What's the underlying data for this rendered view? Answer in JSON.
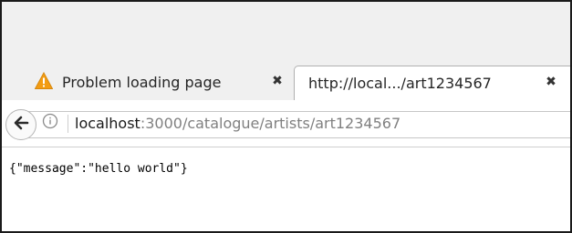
{
  "tabs": [
    {
      "label": "Problem loading page",
      "icon": "warning-icon",
      "active": false
    },
    {
      "label": "http://local.../art1234567",
      "active": true
    }
  ],
  "close_glyph": "✖",
  "urlbar": {
    "host": "localhost",
    "rest": ":3000/catalogue/artists/art1234567"
  },
  "page": {
    "body_text": "{\"message\":\"hello world\"}"
  },
  "colors": {
    "warning": "#f39c12",
    "url_dim": "#808080",
    "url_host": "#1a1a1a"
  }
}
